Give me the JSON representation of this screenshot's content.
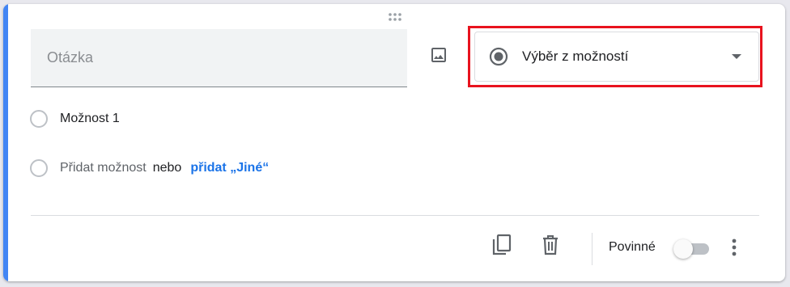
{
  "question": {
    "placeholder": "Otázka"
  },
  "question_type": {
    "selected": "Výběr z možností",
    "icon": "radio-button-checked-icon"
  },
  "options": [
    {
      "label": "Možnost 1"
    }
  ],
  "add_option": {
    "label": "Přidat možnost",
    "or_text": "nebo",
    "add_other_label": "přidat „Jiné“"
  },
  "footer": {
    "duplicate_icon": "copy-icon",
    "delete_icon": "trash-icon",
    "required_label": "Povinné",
    "required_on": false,
    "more_icon": "more-vertical-icon"
  },
  "colors": {
    "accent": "#4285f4",
    "highlight": "#e8131e",
    "link": "#1a73e8"
  }
}
